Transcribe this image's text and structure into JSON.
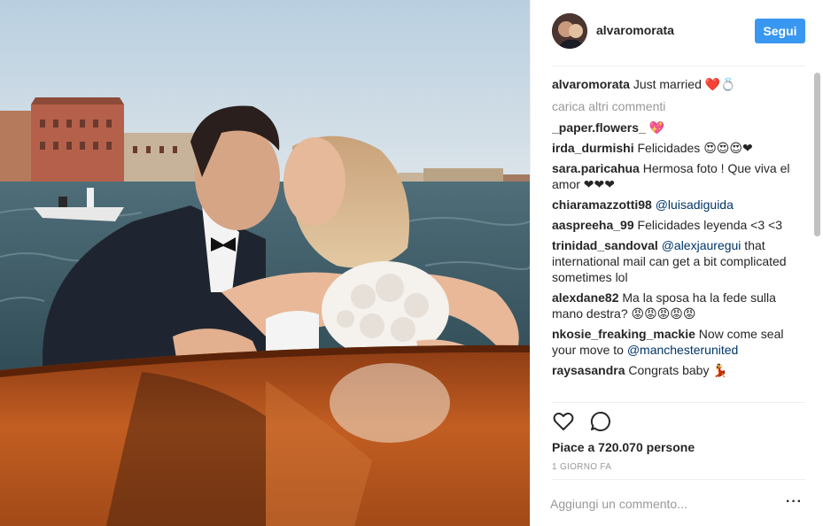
{
  "post": {
    "username": "alvaromorata",
    "follow_label": "Segui",
    "caption_user": "alvaromorata",
    "caption_text": "Just married ❤️💍",
    "load_more": "carica altri commenti",
    "comments": [
      {
        "user": "_paper.flowers_",
        "text": "💖"
      },
      {
        "user": "irda_durmishi",
        "text": "Felicidades 😍😍😍❤"
      },
      {
        "user": "sara.paricahua",
        "text": "Hermosa foto ! Que viva el amor ❤❤❤"
      },
      {
        "user": "chiaramazzotti98",
        "mention": "@luisadiguida",
        "text": ""
      },
      {
        "user": "aaspreeha_99",
        "text": "Felicidades leyenda <3 <3"
      },
      {
        "user": "trinidad_sandoval",
        "mention": "@alexjauregui",
        "text": " that international mail can get a bit complicated sometimes lol"
      },
      {
        "user": "alexdane82",
        "text": "Ma la sposa ha la fede sulla mano destra? 😡😡😡😡😡"
      },
      {
        "user": "nkosie_freaking_mackie",
        "text": "Now come seal your move to ",
        "mention_after": "@manchesterunited"
      },
      {
        "user": "raysasandra",
        "text": "Congrats baby 💃"
      }
    ],
    "likes": "Piace a 720.070 persone",
    "time": "1 GIORNO FA",
    "add_comment_placeholder": "Aggiungi un commento...",
    "more_icon": "···"
  },
  "colors": {
    "accent": "#3897f0",
    "mention": "#003569",
    "muted": "#999999",
    "text": "#262626"
  },
  "icons": {
    "like": "heart-outline-icon",
    "comment": "speech-bubble-icon",
    "more": "ellipsis-icon"
  }
}
